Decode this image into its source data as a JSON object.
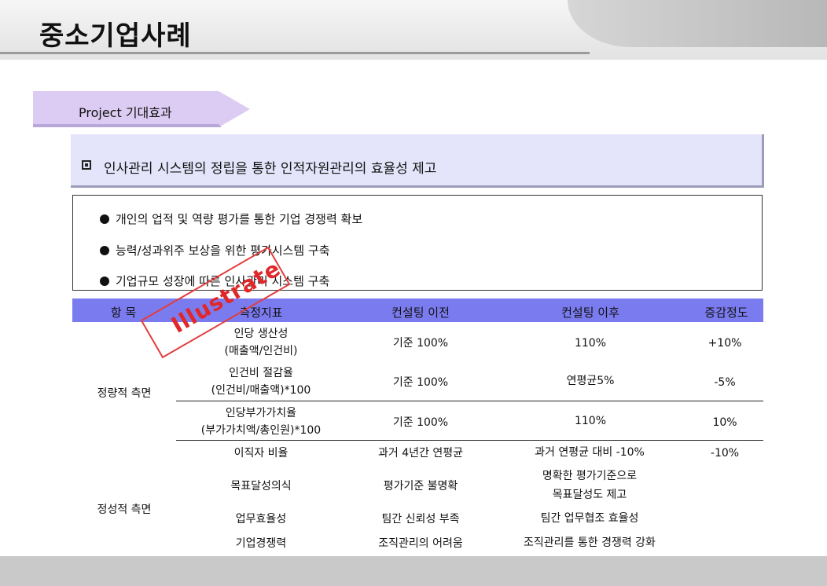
{
  "header": {
    "title": "중소기업사례"
  },
  "section_tag": {
    "label": "Project 기대효과",
    "color": "#dccbf2"
  },
  "banner": {
    "text": "인사관리 시스템의 정립을 통한 인적자원관리의 효율성 제고"
  },
  "bullets": [
    "개인의 업적 및 역량 평가를 통한 기업 경쟁력 확보",
    "능력/성과위주 보상을 위한 평가시스템 구축",
    "기업규모 성장에 따른 인사관리 시스템 구축"
  ],
  "stamp": {
    "text": "Illustrate",
    "color": "#e0282a"
  },
  "table": {
    "header_color": "#7b7bf0",
    "columns": [
      "항 목",
      "측정지표",
      "컨설팅 이전",
      "컨설팅 이후",
      "증감정도"
    ],
    "groups": [
      {
        "category": "정량적 측면",
        "rows": [
          {
            "metric": [
              "인당 생산성",
              "(매출액/인건비)"
            ],
            "before": [
              "기준 100%"
            ],
            "after": [
              "110%"
            ],
            "change": "+10%"
          },
          {
            "metric": [
              "인건비 절감율",
              "(인건비/매출액)*100"
            ],
            "before": [
              "기준 100%"
            ],
            "after": [
              "연평균5%"
            ],
            "change": "-5%"
          },
          {
            "metric": [
              "인당부가가치율",
              "(부가가치액/총인원)*100"
            ],
            "before": [
              "기준 100%"
            ],
            "after": [
              "110%"
            ],
            "change": "10%"
          }
        ]
      },
      {
        "category": "정성적 측면",
        "rows": [
          {
            "metric": [
              "이직자 비율"
            ],
            "before": [
              "과거 4년간 연평균"
            ],
            "after": [
              "과거 연평균 대비 -10%"
            ],
            "change": "-10%"
          },
          {
            "metric": [
              "목표달성의식"
            ],
            "before": [
              "평가기준 불명확"
            ],
            "after": [
              "명확한 평가기준으로",
              "목표달성도 제고"
            ],
            "change": ""
          },
          {
            "metric": [
              "업무효율성"
            ],
            "before": [
              "팀간 신뢰성 부족"
            ],
            "after": [
              "팀간 업무협조 효율성"
            ],
            "change": ""
          },
          {
            "metric": [
              "기업경쟁력"
            ],
            "before": [
              "조직관리의 어려움"
            ],
            "after": [
              "조직관리를 통한 경쟁력 강화"
            ],
            "change": ""
          }
        ]
      }
    ]
  }
}
